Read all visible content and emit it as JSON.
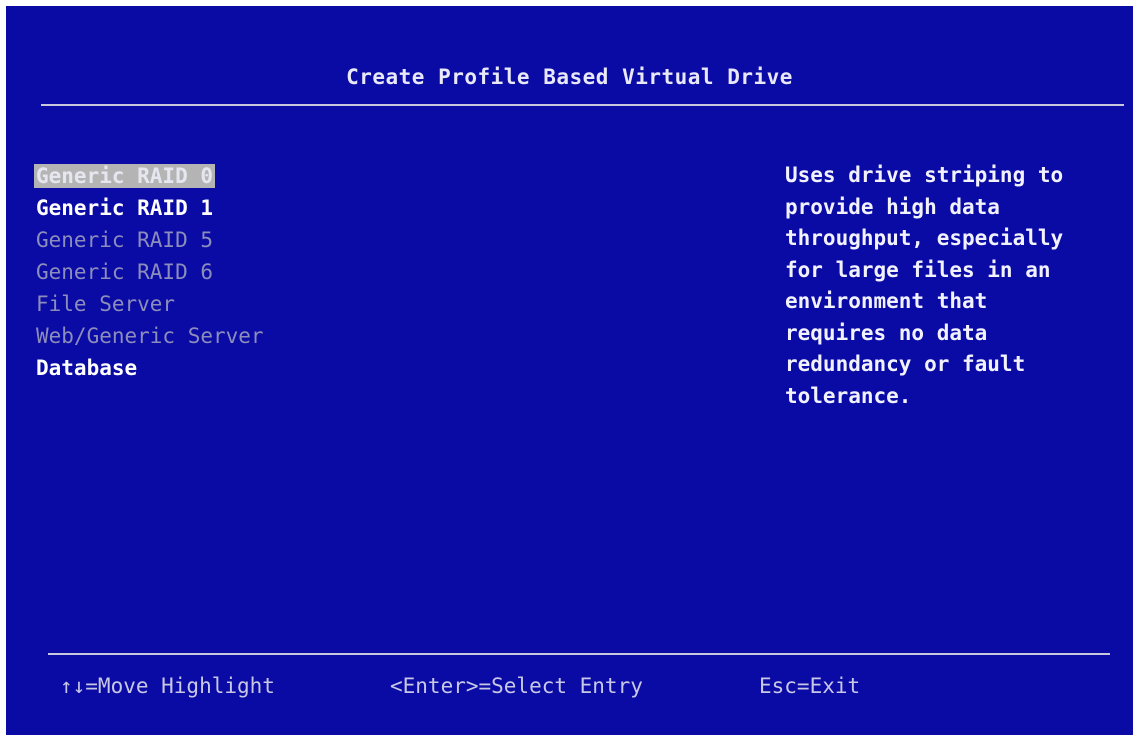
{
  "title": "Create Profile Based Virtual Drive",
  "menu": {
    "items": [
      {
        "label": "Generic RAID 0",
        "state": "highlighted"
      },
      {
        "label": "Generic RAID 1",
        "state": "enabled"
      },
      {
        "label": "Generic RAID 5",
        "state": "disabled"
      },
      {
        "label": "Generic RAID 6",
        "state": "disabled"
      },
      {
        "label": "File Server",
        "state": "disabled"
      },
      {
        "label": "Web/Generic Server",
        "state": "disabled"
      },
      {
        "label": "Database",
        "state": "enabled"
      }
    ]
  },
  "help": {
    "lines": [
      "Uses drive striping to",
      "provide high data",
      "throughput, especially",
      "for large files in an",
      "environment that",
      "requires no data",
      "redundancy or fault",
      "tolerance."
    ]
  },
  "footer": {
    "move": "↑↓=Move Highlight",
    "enter": "<Enter>=Select Entry",
    "exit": "Esc=Exit"
  },
  "colors": {
    "background": "#0a0aa4",
    "highlight": "#b4b4b4",
    "disabled_text": "#8d8dbc",
    "enabled_text": "#ffffff"
  }
}
